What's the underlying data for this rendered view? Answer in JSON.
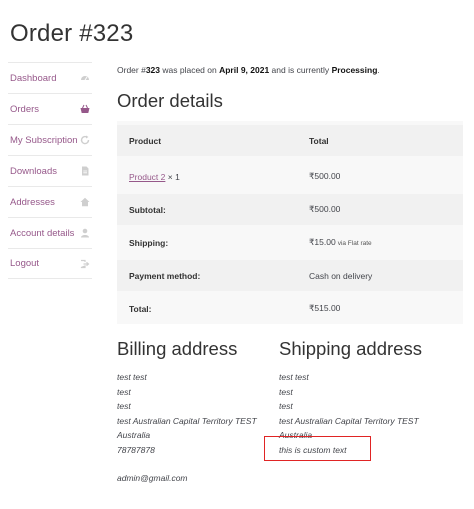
{
  "page": {
    "title": "Order #323"
  },
  "nav": [
    {
      "label": "Dashboard",
      "icon": "dashboard-icon"
    },
    {
      "label": "Orders",
      "icon": "basket-icon"
    },
    {
      "label": "My Subscription",
      "icon": "refresh-icon"
    },
    {
      "label": "Downloads",
      "icon": "file-icon"
    },
    {
      "label": "Addresses",
      "icon": "home-icon"
    },
    {
      "label": "Account details",
      "icon": "user-icon"
    },
    {
      "label": "Logout",
      "icon": "logout-icon"
    }
  ],
  "intro": {
    "prefix": "Order #",
    "order_number": "323",
    "mid1": " was placed on ",
    "date": "April 9, 2021",
    "mid2": " and is currently ",
    "status": "Processing",
    "suffix": "."
  },
  "order_details": {
    "title": "Order details",
    "headers": {
      "product": "Product",
      "total": "Total"
    },
    "item": {
      "name": "Product 2",
      "qty": " × 1",
      "total": "₹500.00"
    },
    "subtotal": {
      "label": "Subtotal:",
      "value": "₹500.00"
    },
    "shipping": {
      "label": "Shipping:",
      "value": "₹15.00",
      "via": "via Flat rate"
    },
    "payment": {
      "label": "Payment method:",
      "value": "Cash on delivery"
    },
    "total": {
      "label": "Total:",
      "value": "₹515.00"
    }
  },
  "billing": {
    "title": "Billing address",
    "lines": [
      "test test",
      "test",
      "test",
      "test Australian Capital Territory TEST",
      "Australia",
      "78787878"
    ],
    "email": "admin@gmail.com"
  },
  "shipping_address": {
    "title": "Shipping address",
    "lines": [
      "test test",
      "test",
      "test",
      "test Australian Capital Territory TEST",
      "Australia"
    ],
    "custom_text": "this is custom text"
  },
  "colors": {
    "accent": "#96588a",
    "table_bg": "#f8f8f8",
    "highlight": "#e02424"
  }
}
